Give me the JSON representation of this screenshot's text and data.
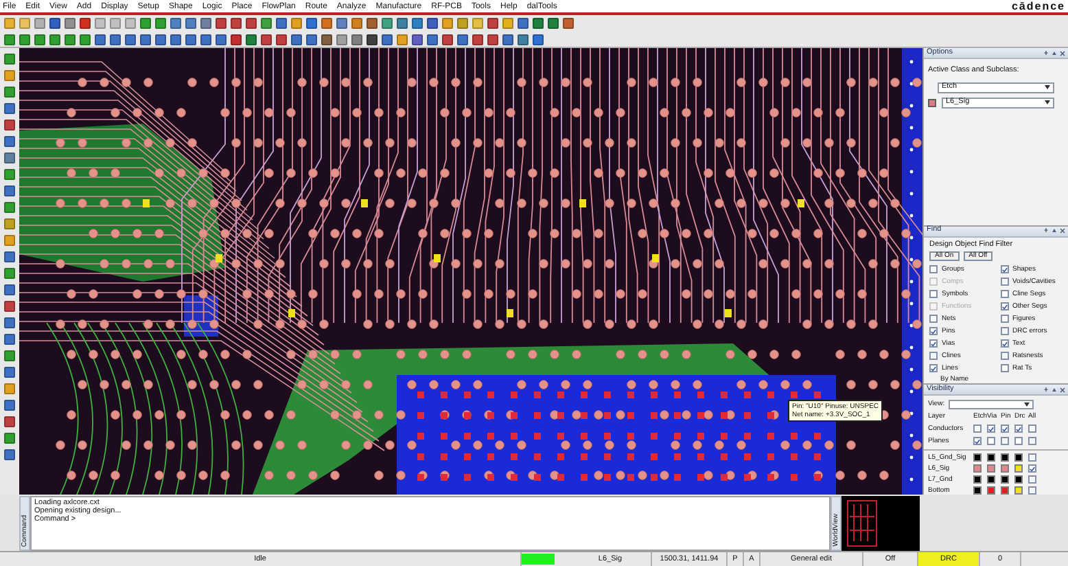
{
  "menu": [
    "File",
    "Edit",
    "View",
    "Add",
    "Display",
    "Setup",
    "Shape",
    "Logic",
    "Place",
    "FlowPlan",
    "Route",
    "Analyze",
    "Manufacture",
    "RF-PCB",
    "Tools",
    "Help",
    "dalTools"
  ],
  "logo": "cādence",
  "tooltip": {
    "lines": [
      "Pin: \"U10\"  Pinuse: UNSPEC",
      "Net name: +3.3V_SOC_1"
    ]
  },
  "options": {
    "title": "Options",
    "heading": "Active Class and Subclass:",
    "class": "Etch",
    "subclass": {
      "name": "L6_Sig",
      "color": "#e07a88"
    }
  },
  "find": {
    "title": "Find",
    "heading": "Design Object Find Filter",
    "buttons": [
      "All On",
      "All Off"
    ],
    "by_name": "By Name",
    "items": [
      {
        "label": "Groups",
        "checked": false,
        "disabled": false
      },
      {
        "label": "Shapes",
        "checked": true,
        "disabled": false
      },
      {
        "label": "Comps",
        "checked": false,
        "disabled": true
      },
      {
        "label": "Voids/Cavities",
        "checked": false,
        "disabled": false
      },
      {
        "label": "Symbols",
        "checked": false,
        "disabled": false
      },
      {
        "label": "Cline Segs",
        "checked": false,
        "disabled": false
      },
      {
        "label": "Functions",
        "checked": false,
        "disabled": true
      },
      {
        "label": "Other Segs",
        "checked": true,
        "disabled": false
      },
      {
        "label": "Nets",
        "checked": false,
        "disabled": false
      },
      {
        "label": "Figures",
        "checked": false,
        "disabled": false
      },
      {
        "label": "Pins",
        "checked": true,
        "disabled": false
      },
      {
        "label": "DRC errors",
        "checked": false,
        "disabled": false
      },
      {
        "label": "Vias",
        "checked": true,
        "disabled": false
      },
      {
        "label": "Text",
        "checked": true,
        "disabled": false
      },
      {
        "label": "Clines",
        "checked": false,
        "disabled": false
      },
      {
        "label": "Ratsnests",
        "checked": false,
        "disabled": false
      },
      {
        "label": "Lines",
        "checked": true,
        "disabled": false
      },
      {
        "label": "Rat Ts",
        "checked": false,
        "disabled": false
      }
    ]
  },
  "visibility": {
    "title": "Visibility",
    "view_label": "View:",
    "layer_label": "Layer",
    "columns": [
      "Etch",
      "Via",
      "Pin",
      "Drc",
      "All"
    ],
    "rows": [
      {
        "label": "Conductors",
        "checks": [
          false,
          true,
          true,
          true,
          false
        ]
      },
      {
        "label": "Planes",
        "checks": [
          true,
          false,
          false,
          false,
          false
        ]
      }
    ],
    "layers": [
      {
        "name": "L5_Gnd_Sig",
        "swatches": [
          {
            "color": "#000000"
          },
          {
            "color": "#000000"
          },
          {
            "color": "#000000"
          },
          {
            "color": "#000000"
          }
        ],
        "all": false
      },
      {
        "name": "L6_Sig",
        "swatches": [
          {
            "color": "#e08890"
          },
          {
            "color": "#e08890"
          },
          {
            "color": "#e08890"
          },
          {
            "color": "#f0e020"
          }
        ],
        "all": true
      },
      {
        "name": "L7_Gnd",
        "swatches": [
          {
            "color": "#000000"
          },
          {
            "color": "#000000"
          },
          {
            "color": "#000000"
          },
          {
            "color": "#000000"
          }
        ],
        "all": false
      },
      {
        "name": "Bottom",
        "swatches": [
          {
            "color": "#000000"
          },
          {
            "color": "#e02020"
          },
          {
            "color": "#e02020"
          },
          {
            "color": "#f0e020"
          }
        ],
        "all": false
      }
    ]
  },
  "console": {
    "label": "Command",
    "lines": [
      "Loading axlcore.cxt",
      "Opening existing design...",
      "Command >"
    ]
  },
  "worldview": {
    "label": "WorldView"
  },
  "status": [
    {
      "kind": "text",
      "text": "Idle",
      "highlight": false
    },
    {
      "kind": "indicator",
      "color": "#22ee22"
    },
    {
      "kind": "text",
      "text": "L6_Sig",
      "highlight": false
    },
    {
      "kind": "text",
      "text": "1500.31, 1411.94",
      "highlight": false
    },
    {
      "kind": "text",
      "text": "P",
      "highlight": false
    },
    {
      "kind": "text",
      "text": "A",
      "highlight": false
    },
    {
      "kind": "text",
      "text": "General edit",
      "highlight": false
    },
    {
      "kind": "text",
      "text": "Off",
      "highlight": false
    },
    {
      "kind": "text",
      "text": "DRC",
      "highlight": true
    },
    {
      "kind": "text",
      "text": "0",
      "highlight": false
    }
  ]
}
